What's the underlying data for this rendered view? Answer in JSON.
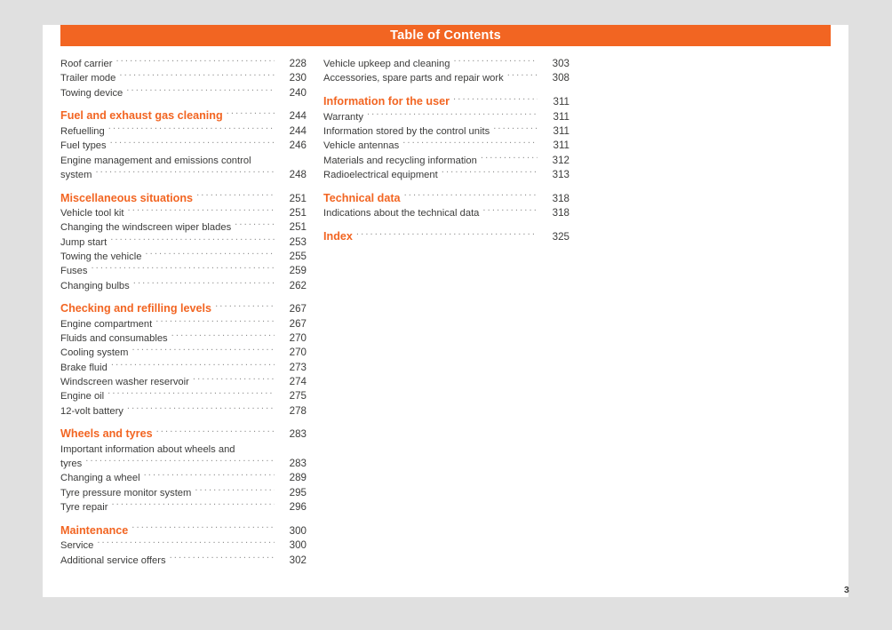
{
  "document": {
    "banner_title": "Table of Contents",
    "folio": "3",
    "accent_color": "#f26522",
    "text_color": "#3c3c3b",
    "page_background": "#ffffff",
    "canvas_background": "#e0e0e0"
  },
  "columns": [
    {
      "id": "left",
      "entries": [
        {
          "label": "Roof carrier",
          "page": "228",
          "type": "item",
          "gap": false,
          "leader": true
        },
        {
          "label": "Trailer mode",
          "page": "230",
          "type": "item",
          "gap": false,
          "leader": true
        },
        {
          "label": "Towing device",
          "page": "240",
          "type": "item",
          "gap": false,
          "leader": true
        },
        {
          "label": "Fuel and exhaust gas cleaning",
          "page": "244",
          "type": "section",
          "gap": true,
          "leader": true
        },
        {
          "label": "Refuelling",
          "page": "244",
          "type": "item",
          "gap": false,
          "leader": true
        },
        {
          "label": "Fuel types",
          "page": "246",
          "type": "item",
          "gap": false,
          "leader": true
        },
        {
          "label": "Engine management and emissions control",
          "page": "",
          "type": "item",
          "gap": false,
          "leader": false
        },
        {
          "label": "system",
          "page": "248",
          "type": "item",
          "gap": false,
          "leader": true
        },
        {
          "label": "Miscellaneous situations",
          "page": "251",
          "type": "section",
          "gap": true,
          "leader": true
        },
        {
          "label": "Vehicle tool kit",
          "page": "251",
          "type": "item",
          "gap": false,
          "leader": true
        },
        {
          "label": "Changing the windscreen wiper blades",
          "page": "251",
          "type": "item",
          "gap": false,
          "leader": true
        },
        {
          "label": "Jump start",
          "page": "253",
          "type": "item",
          "gap": false,
          "leader": true
        },
        {
          "label": "Towing the vehicle",
          "page": "255",
          "type": "item",
          "gap": false,
          "leader": true
        },
        {
          "label": "Fuses",
          "page": "259",
          "type": "item",
          "gap": false,
          "leader": true
        },
        {
          "label": "Changing bulbs",
          "page": "262",
          "type": "item",
          "gap": false,
          "leader": true
        },
        {
          "label": "Checking and refilling levels",
          "page": "267",
          "type": "section",
          "gap": true,
          "leader": true
        },
        {
          "label": "Engine compartment",
          "page": "267",
          "type": "item",
          "gap": false,
          "leader": true
        },
        {
          "label": "Fluids and consumables",
          "page": "270",
          "type": "item",
          "gap": false,
          "leader": true
        },
        {
          "label": "Cooling system",
          "page": "270",
          "type": "item",
          "gap": false,
          "leader": true
        },
        {
          "label": "Brake fluid",
          "page": "273",
          "type": "item",
          "gap": false,
          "leader": true
        },
        {
          "label": "Windscreen washer reservoir",
          "page": "274",
          "type": "item",
          "gap": false,
          "leader": true
        },
        {
          "label": "Engine oil",
          "page": "275",
          "type": "item",
          "gap": false,
          "leader": true
        },
        {
          "label": "12-volt battery",
          "page": "278",
          "type": "item",
          "gap": false,
          "leader": true
        },
        {
          "label": "Wheels and tyres",
          "page": "283",
          "type": "section",
          "gap": true,
          "leader": true
        },
        {
          "label": "Important information about wheels and",
          "page": "",
          "type": "item",
          "gap": false,
          "leader": false
        },
        {
          "label": "tyres",
          "page": "283",
          "type": "item",
          "gap": false,
          "leader": true
        },
        {
          "label": "Changing a wheel",
          "page": "289",
          "type": "item",
          "gap": false,
          "leader": true
        },
        {
          "label": "Tyre pressure monitor system",
          "page": "295",
          "type": "item",
          "gap": false,
          "leader": true
        },
        {
          "label": "Tyre repair",
          "page": "296",
          "type": "item",
          "gap": false,
          "leader": true
        },
        {
          "label": "Maintenance",
          "page": "300",
          "type": "section",
          "gap": true,
          "leader": true
        },
        {
          "label": "Service",
          "page": "300",
          "type": "item",
          "gap": false,
          "leader": true
        },
        {
          "label": "Additional service offers",
          "page": "302",
          "type": "item",
          "gap": false,
          "leader": true
        }
      ]
    },
    {
      "id": "right",
      "entries": [
        {
          "label": "Vehicle upkeep and cleaning",
          "page": "303",
          "type": "item",
          "gap": false,
          "leader": true
        },
        {
          "label": "Accessories, spare parts and repair work",
          "page": "308",
          "type": "item",
          "gap": false,
          "leader": true
        },
        {
          "label": "Information for the user",
          "page": "311",
          "type": "section",
          "gap": true,
          "leader": true
        },
        {
          "label": "Warranty",
          "page": "311",
          "type": "item",
          "gap": false,
          "leader": true
        },
        {
          "label": "Information stored by the control units",
          "page": "311",
          "type": "item",
          "gap": false,
          "leader": true
        },
        {
          "label": "Vehicle antennas",
          "page": "311",
          "type": "item",
          "gap": false,
          "leader": true
        },
        {
          "label": "Materials and recycling information",
          "page": "312",
          "type": "item",
          "gap": false,
          "leader": true
        },
        {
          "label": "Radioelectrical equipment",
          "page": "313",
          "type": "item",
          "gap": false,
          "leader": true
        },
        {
          "label": "Technical data",
          "page": "318",
          "type": "section",
          "gap": true,
          "leader": true
        },
        {
          "label": "Indications about the technical data",
          "page": "318",
          "type": "item",
          "gap": false,
          "leader": true
        },
        {
          "label": "Index",
          "page": "325",
          "type": "section",
          "gap": true,
          "leader": true
        }
      ]
    }
  ]
}
